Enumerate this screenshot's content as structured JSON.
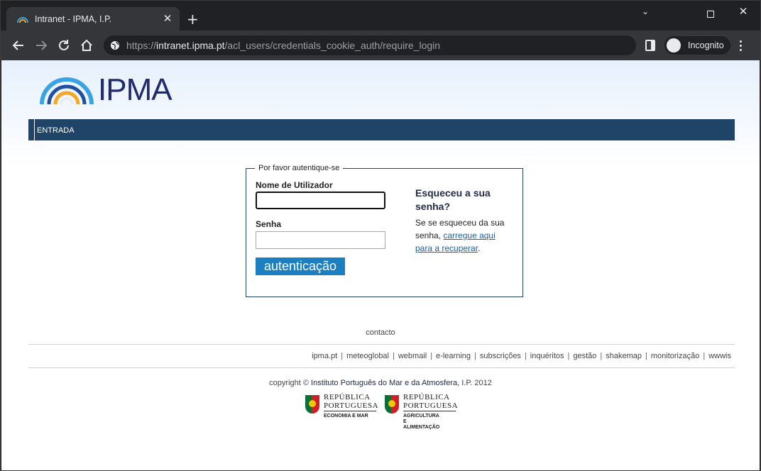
{
  "browser": {
    "tab_title": "Intranet - IPMA, I.P.",
    "url_prefix": "https://",
    "url_host": "intranet.ipma.pt",
    "url_path": "/acl_users/credentials_cookie_auth/require_login",
    "incognito_label": "Incognito"
  },
  "header": {
    "logo_text": "IPMA",
    "nav_item": "ENTRADA"
  },
  "login": {
    "legend": "Por favor autentique-se",
    "username_label": "Nome de Utilizador",
    "username_value": "",
    "password_label": "Senha",
    "password_value": "",
    "submit_label": "autenticação",
    "forgot_heading": "Esqueceu a sua senha?",
    "forgot_text_before": "Se se esqueceu da sua senha, ",
    "forgot_link": "carregue aqui para a recuperar",
    "forgot_text_after": "."
  },
  "footer": {
    "contact": "contacto",
    "links": [
      "ipma.pt",
      "meteoglobal",
      "webmail",
      "e-learning",
      "subscrições",
      "inquéritos",
      "gestão",
      "shakemap",
      "monitorização",
      "wwwis"
    ],
    "copyright_before": "copyright © ",
    "copyright_link": "Instituto Português do Mar e da Atmosfera",
    "copyright_after": ", I.P. 2012",
    "logos": [
      {
        "line1": "REPÚBLICA",
        "line2": "PORTUGUESA",
        "sub": "ECONOMIA E MAR"
      },
      {
        "line1": "REPÚBLICA",
        "line2": "PORTUGUESA",
        "sub": "AGRICULTURA E ALIMENTAÇÃO"
      }
    ]
  },
  "colors": {
    "navbar": "#1f4468",
    "button": "#1b7fc2",
    "browser_frame": "#202124"
  }
}
